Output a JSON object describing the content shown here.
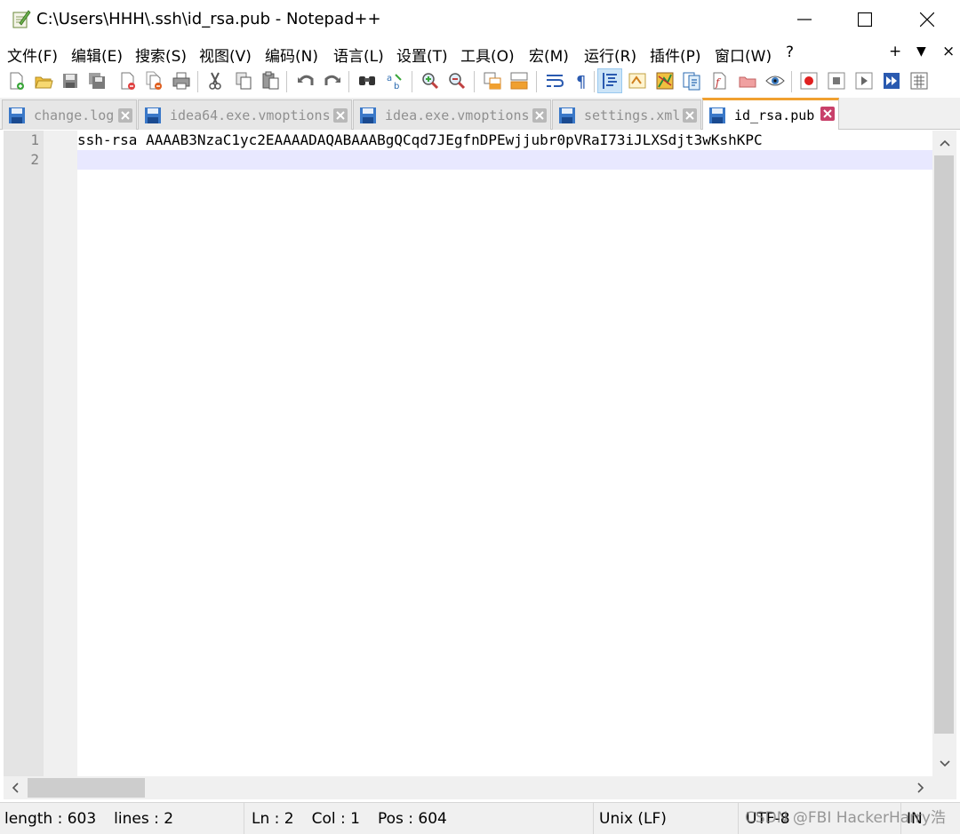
{
  "window": {
    "title": "C:\\Users\\HHH\\.ssh\\id_rsa.pub - Notepad++",
    "app_icon": "notepad-plus-plus-icon",
    "controls": {
      "minimize": "minimize-icon",
      "maximize": "maximize-icon",
      "close": "close-icon"
    }
  },
  "menubar": {
    "items": [
      {
        "label": "文件(F)"
      },
      {
        "label": "编辑(E)"
      },
      {
        "label": "搜索(S)"
      },
      {
        "label": "视图(V)"
      },
      {
        "label": "编码(N)"
      },
      {
        "label": "语言(L)"
      },
      {
        "label": "设置(T)"
      },
      {
        "label": "工具(O)"
      },
      {
        "label": "宏(M)"
      },
      {
        "label": "运行(R)"
      },
      {
        "label": "插件(P)"
      },
      {
        "label": "窗口(W)"
      },
      {
        "label": "?"
      }
    ],
    "right": {
      "plus": "+",
      "down": "▼",
      "close": "×"
    }
  },
  "toolbar": {
    "buttons": [
      "new-file-icon",
      "open-file-icon",
      "save-icon",
      "save-all-icon",
      "close-icon",
      "close-all-icon",
      "print-icon",
      "cut-icon",
      "copy-icon",
      "paste-icon",
      "undo-icon",
      "redo-icon",
      "find-icon",
      "replace-icon",
      "zoom-in-icon",
      "zoom-out-icon",
      "sync-vertical-icon",
      "sync-horizontal-icon",
      "word-wrap-icon",
      "show-all-chars-icon",
      "indent-guide-icon",
      "user-language-icon",
      "document-map-icon",
      "function-list-icon",
      "folder-as-workspace-icon",
      "monitoring-icon",
      "eye-icon",
      "record-macro-icon",
      "stop-macro-icon",
      "play-macro-icon",
      "run-macro-multiple-icon",
      "save-macro-icon"
    ]
  },
  "tabs": [
    {
      "label": "change.log",
      "active": false
    },
    {
      "label": "idea64.exe.vmoptions",
      "active": false
    },
    {
      "label": "idea.exe.vmoptions",
      "active": false
    },
    {
      "label": "settings.xml",
      "active": false
    },
    {
      "label": "id_rsa.pub",
      "active": true
    }
  ],
  "editor": {
    "line_numbers": [
      "1",
      "2"
    ],
    "lines": [
      "ssh-rsa AAAAB3NzaC1yc2EAAAADAQABAAABgQCqd7JEgfnDPEwjjubr0pVRaI73iJLXSdjt3wKshKPC",
      ""
    ],
    "current_line": 2
  },
  "statusbar": {
    "length": "length : 603",
    "lines": "lines : 2",
    "ln": "Ln : 2",
    "col": "Col : 1",
    "pos": "Pos : 604",
    "eol": "Unix (LF)",
    "encoding": "UTF-8",
    "mode": "IN"
  },
  "watermark": "CSDN @FBI HackerHarry浩"
}
